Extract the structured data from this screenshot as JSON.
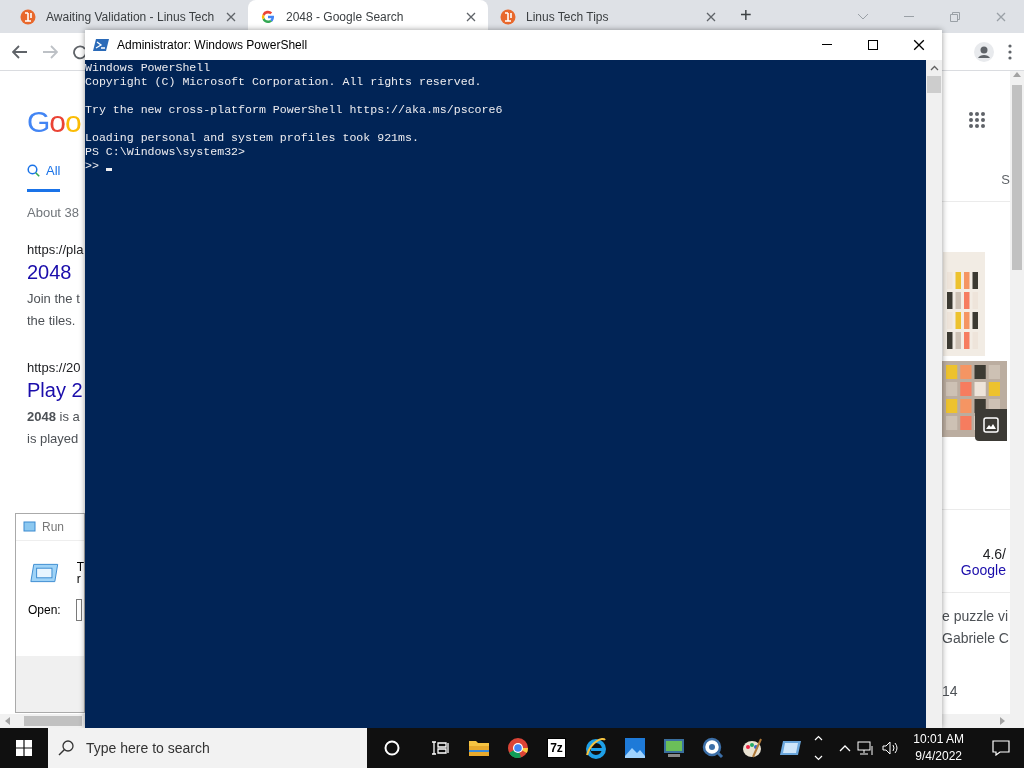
{
  "browser": {
    "tabs": [
      {
        "title": "Awaiting Validation - Linus Tech",
        "selected": false,
        "kind": "forum"
      },
      {
        "title": "2048 - Google Search",
        "selected": true,
        "kind": "google"
      },
      {
        "title": "Linus Tech Tips",
        "selected": false,
        "kind": "forum"
      }
    ],
    "new_tab": "+",
    "logo": "Goo",
    "search_tabs": [
      {
        "label": "All",
        "selected": true
      },
      {
        "label": "S",
        "selected": false
      }
    ],
    "result_stats": "About 38",
    "results": [
      {
        "url": "https://pla",
        "title": "2048",
        "snippet": [
          "Join the t",
          "the tiles."
        ]
      },
      {
        "url": "https://20",
        "title": "Play 2",
        "snippet": [
          "**2048** is a",
          "is played"
        ]
      }
    ],
    "side_panel": {
      "rating": "4.6/",
      "source": "Google",
      "snippet": [
        "e puzzle vi",
        "Gabriele C"
      ],
      "footer": "14"
    }
  },
  "run_dialog": {
    "title": "Run",
    "text": [
      "T",
      "r"
    ],
    "open_label": "Open:"
  },
  "powershell": {
    "title": "Administrator: Windows PowerShell",
    "paragraphs": [
      [
        "Windows PowerShell",
        "Copyright (C) Microsoft Corporation. All rights reserved."
      ],
      [
        "Try the new cross-platform PowerShell https://aka.ms/pscore6"
      ],
      [
        "Loading personal and system profiles took 921ms.",
        "PS C:\\Windows\\system32>",
        ">>"
      ]
    ]
  },
  "taskbar": {
    "search_placeholder": "Type here to search",
    "apps": [
      {
        "kind": "folder"
      },
      {
        "kind": "chrome"
      },
      {
        "kind": "archiver",
        "label": "7z"
      },
      {
        "kind": "ie"
      },
      {
        "kind": "photos"
      },
      {
        "kind": "monitor"
      },
      {
        "kind": "magnifier"
      },
      {
        "kind": "paint"
      },
      {
        "kind": "tablet"
      }
    ],
    "time": "10:01 AM",
    "date": "9/4/2022"
  }
}
